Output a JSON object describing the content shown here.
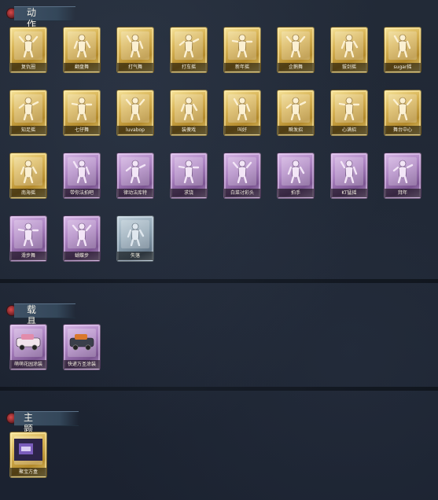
{
  "sections": [
    {
      "title": "动作",
      "items": [
        {
          "label": "复仇圈",
          "rarity": "gold"
        },
        {
          "label": "翻盘舞",
          "rarity": "gold"
        },
        {
          "label": "打气舞",
          "rarity": "gold"
        },
        {
          "label": "打车摇",
          "rarity": "gold"
        },
        {
          "label": "新年摇",
          "rarity": "gold"
        },
        {
          "label": "企鹅舞",
          "rarity": "gold"
        },
        {
          "label": "拔剑摇",
          "rarity": "gold"
        },
        {
          "label": "sugar摇",
          "rarity": "gold"
        },
        {
          "label": "知足摇",
          "rarity": "gold"
        },
        {
          "label": "七仔舞",
          "rarity": "gold"
        },
        {
          "label": "luvabop",
          "rarity": "gold"
        },
        {
          "label": "装傻戏",
          "rarity": "gold"
        },
        {
          "label": "叫好",
          "rarity": "gold"
        },
        {
          "label": "瞬发招",
          "rarity": "gold"
        },
        {
          "label": "心满招",
          "rarity": "gold"
        },
        {
          "label": "舞台中心",
          "rarity": "gold"
        },
        {
          "label": "南海摇",
          "rarity": "gold"
        },
        {
          "label": "带你法拍吧",
          "rarity": "purple"
        },
        {
          "label": "律动法库特",
          "rarity": "purple"
        },
        {
          "label": "求饶",
          "rarity": "purple"
        },
        {
          "label": "白菜讨彩头",
          "rarity": "purple"
        },
        {
          "label": "拍手",
          "rarity": "purple"
        },
        {
          "label": "KT猛摇",
          "rarity": "purple"
        },
        {
          "label": "拜年",
          "rarity": "purple"
        },
        {
          "label": "滑步舞",
          "rarity": "purple"
        },
        {
          "label": "蝴蝶步",
          "rarity": "purple"
        },
        {
          "label": "失落",
          "rarity": "blue"
        }
      ]
    },
    {
      "title": "载具",
      "items": [
        {
          "label": "萌萌花园涂装",
          "rarity": "purple"
        },
        {
          "label": "快递万圣涂装",
          "rarity": "purple"
        }
      ]
    },
    {
      "title": "主题场景",
      "items": [
        {
          "label": "聚宝方盒",
          "rarity": "gold"
        }
      ]
    }
  ]
}
